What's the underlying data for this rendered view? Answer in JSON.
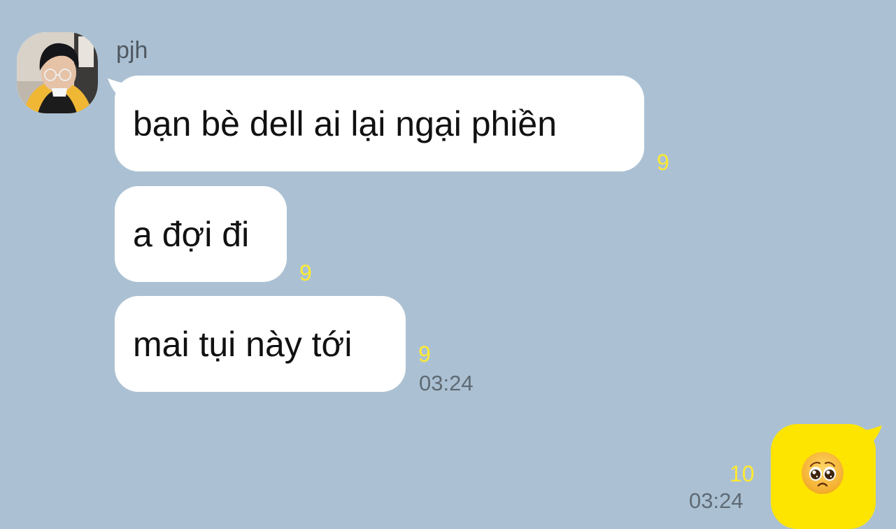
{
  "chat": {
    "sender_name": "pjh",
    "messages": [
      {
        "text": "bạn bè dell ai lại ngại phiền",
        "unread_count": "9"
      },
      {
        "text": "a đợi đi",
        "unread_count": "9"
      },
      {
        "text": "mai tụi này tới",
        "unread_count": "9",
        "time": "03:24"
      }
    ],
    "my_message": {
      "emoji": "pleading-face-emoji",
      "unread_count": "10",
      "time": "03:24"
    }
  },
  "icons": {
    "avatar": "profile-photo",
    "reaction": "pleading-face-emoji"
  },
  "colors": {
    "background": "#abc1d3",
    "incoming_bubble": "#ffffff",
    "outgoing_bubble": "#fee500",
    "unread_count": "#ffea31",
    "timestamp": "#5f6a74"
  }
}
